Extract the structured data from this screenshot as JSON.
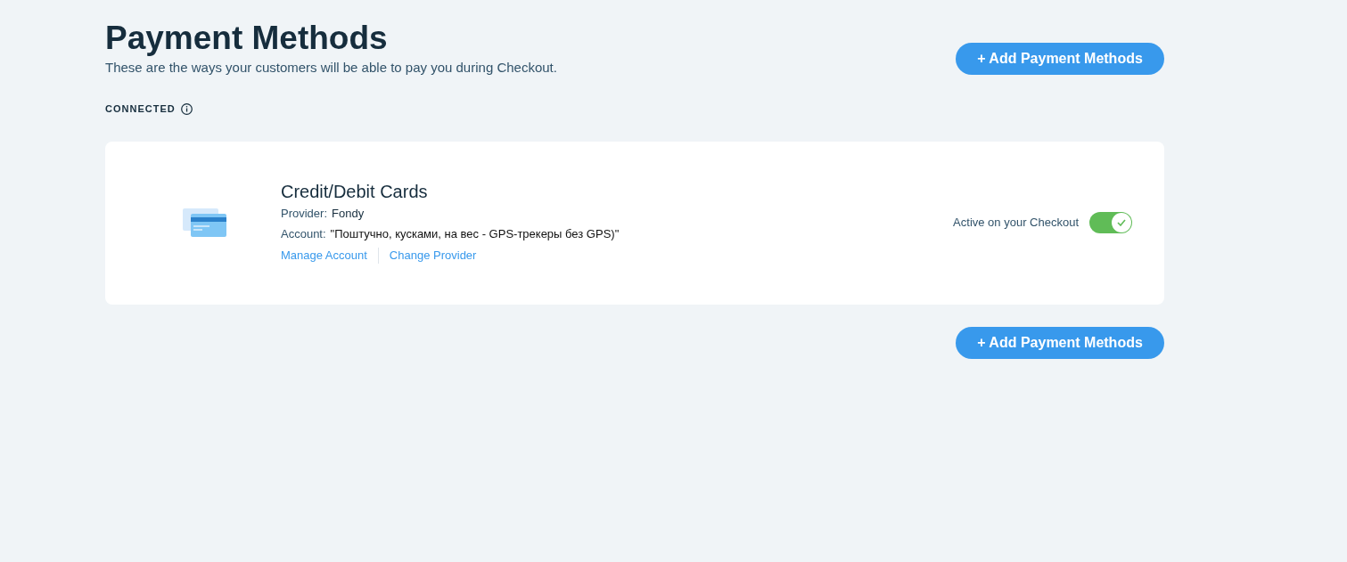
{
  "header": {
    "title": "Payment Methods",
    "subtitle": "These are the ways your customers will be able to pay you during Checkout.",
    "add_button": "+ Add Payment Methods"
  },
  "section": {
    "label": "CONNECTED"
  },
  "methods": [
    {
      "name": "Credit/Debit Cards",
      "provider_label": "Provider:",
      "provider": "Fondy",
      "account_label": "Account:",
      "account": "\"Поштучно, кусками, на вес - GPS-трекеры без GPS)\"",
      "links": [
        "Manage Account",
        "Change Provider"
      ],
      "toggle_label": "Active on your Checkout",
      "on": true
    }
  ],
  "footer": {
    "add_button": "+ Add Payment Methods"
  }
}
